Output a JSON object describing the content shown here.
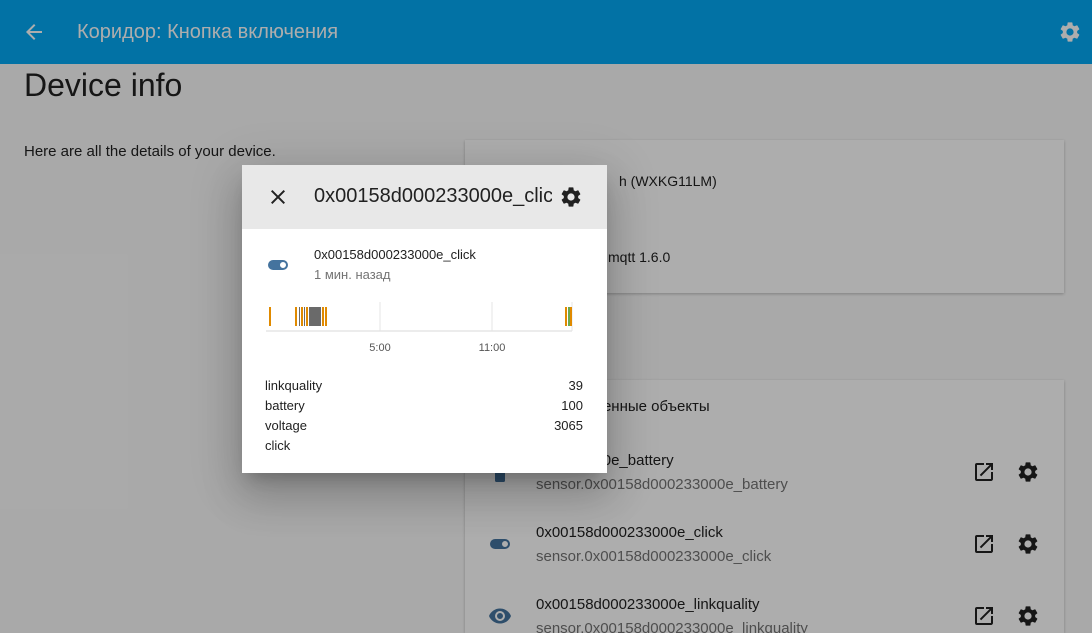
{
  "header": {
    "title": "Коридор: Кнопка включения"
  },
  "page": {
    "title": "Device info",
    "description": "Here are all the details of your device."
  },
  "device_card": {
    "model": "h (WXKG11LM)",
    "firmware": "mqtt 1.6.0"
  },
  "entities_card": {
    "show_disabled": "ать отключенные объекты",
    "rows": [
      {
        "name": "000233000e_battery",
        "entity_id": "sensor.0x00158d000233000e_battery",
        "icon": "battery-icon"
      },
      {
        "name": "0x00158d000233000e_click",
        "entity_id": "sensor.0x00158d000233000e_click",
        "icon": "toggle-icon"
      },
      {
        "name": "0x00158d000233000e_linkquality",
        "entity_id": "sensor.0x00158d000233000e_linkquality",
        "icon": "eye-icon"
      }
    ]
  },
  "dialog": {
    "title": "0x00158d000233000e_click",
    "state_name": "0x00158d000233000e_click",
    "state_time": "1 мин. назад",
    "attributes": [
      {
        "key": "linkquality",
        "value": "39"
      },
      {
        "key": "battery",
        "value": "100"
      },
      {
        "key": "voltage",
        "value": "3065"
      },
      {
        "key": "click",
        "value": ""
      }
    ]
  },
  "timeline": {
    "ticks": [
      "5:00",
      "11:00"
    ]
  },
  "colors": {
    "header_bg": "#03a9f4",
    "icon_state": "#44739e",
    "timeline_orange": "#e08a00",
    "timeline_gray": "#6a6a6a",
    "timeline_green": "#6aa84f"
  }
}
